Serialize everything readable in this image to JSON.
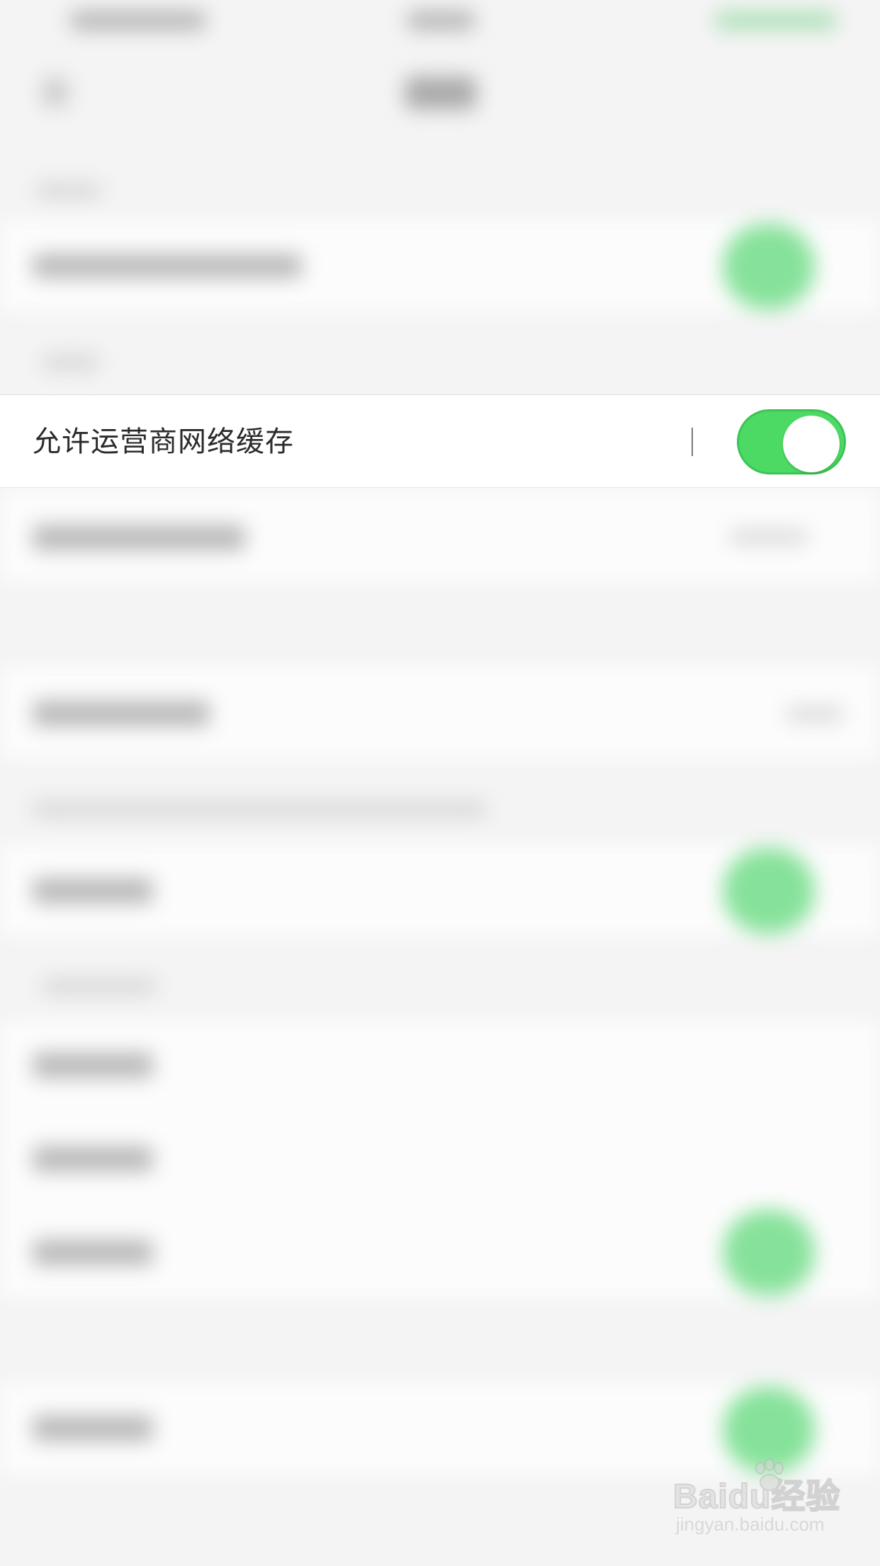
{
  "focused_setting": {
    "label": "允许运营商网络缓存",
    "toggle_state": "on"
  },
  "colors": {
    "toggle_on": "#4cd964",
    "page_background": "#f4f4f4",
    "row_background": "#ffffff"
  },
  "watermark": {
    "logo_text": "Baidu经验",
    "url": "jingyan.baidu.com"
  }
}
